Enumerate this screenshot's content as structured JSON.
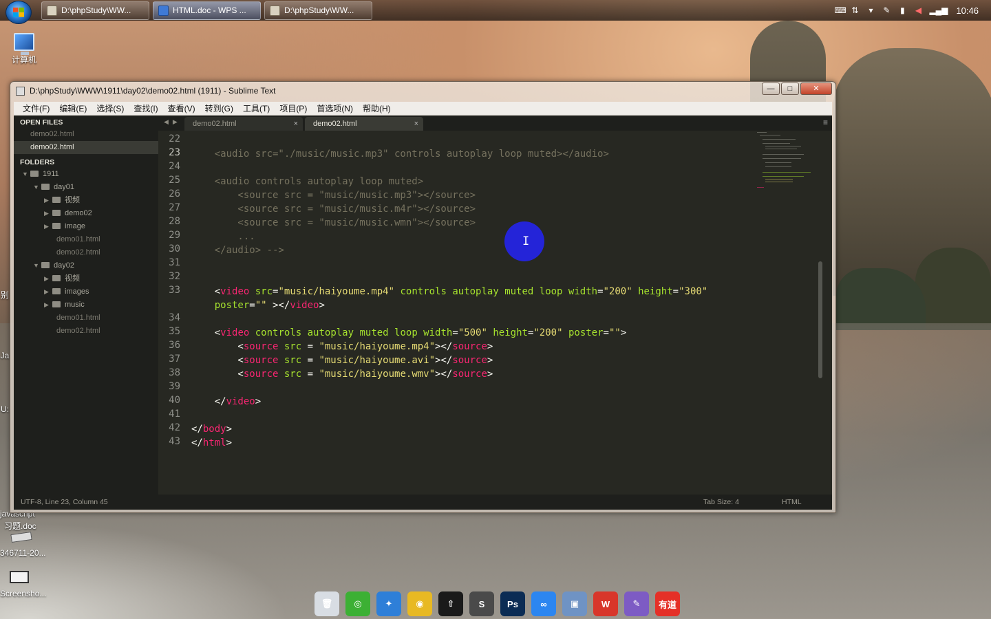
{
  "taskbar": {
    "buttons": [
      {
        "label": "D:\\phpStudy\\WW...",
        "active": false
      },
      {
        "label": "HTML.doc - WPS ...",
        "active": true
      },
      {
        "label": "D:\\phpStudy\\WW...",
        "active": false
      }
    ],
    "clock": "10:46"
  },
  "desktop": {
    "computer_label": "计算机",
    "left_fragments": [
      "Ja",
      "U:",
      "别"
    ],
    "files": [
      "javascript",
      "习题.doc",
      "346711-20...",
      "Screensho..."
    ]
  },
  "window": {
    "title": "D:\\phpStudy\\WWW\\1911\\day02\\demo02.html (1911) - Sublime Text",
    "controls": {
      "minimize": "—",
      "maximize": "□",
      "close": "✕"
    },
    "menu": [
      "文件(F)",
      "编辑(E)",
      "选择(S)",
      "查找(I)",
      "查看(V)",
      "转到(G)",
      "工具(T)",
      "项目(P)",
      "首选项(N)",
      "帮助(H)"
    ]
  },
  "sidebar": {
    "open_files_header": "OPEN FILES",
    "open_files": [
      {
        "name": "demo02.html",
        "selected": false
      },
      {
        "name": "demo02.html",
        "selected": true
      }
    ],
    "folders_header": "FOLDERS",
    "tree": [
      {
        "name": "1911",
        "depth": 0,
        "type": "folder",
        "open": true
      },
      {
        "name": "day01",
        "depth": 1,
        "type": "folder",
        "open": true
      },
      {
        "name": "视频",
        "depth": 2,
        "type": "folder",
        "open": false
      },
      {
        "name": "demo02",
        "depth": 2,
        "type": "folder",
        "open": false
      },
      {
        "name": "image",
        "depth": 2,
        "type": "folder",
        "open": false
      },
      {
        "name": "demo01.html",
        "depth": 2,
        "type": "file"
      },
      {
        "name": "demo02.html",
        "depth": 2,
        "type": "file"
      },
      {
        "name": "day02",
        "depth": 1,
        "type": "folder",
        "open": true
      },
      {
        "name": "视频",
        "depth": 2,
        "type": "folder",
        "open": false
      },
      {
        "name": "images",
        "depth": 2,
        "type": "folder",
        "open": false
      },
      {
        "name": "music",
        "depth": 2,
        "type": "folder",
        "open": false
      },
      {
        "name": "demo01.html",
        "depth": 2,
        "type": "file"
      },
      {
        "name": "demo02.html",
        "depth": 2,
        "type": "file"
      }
    ]
  },
  "tabs": [
    {
      "label": "demo02.html",
      "active": false,
      "close": "×"
    },
    {
      "label": "demo02.html",
      "active": true,
      "close": "×"
    }
  ],
  "editor": {
    "current_line": "23",
    "lines": [
      {
        "n": "22",
        "tokens": []
      },
      {
        "n": "23",
        "tokens": [
          {
            "t": "    <audio src=\"./music/music.mp3\" controls autoplay loop muted></audio>",
            "c": "cm"
          }
        ]
      },
      {
        "n": "24",
        "tokens": []
      },
      {
        "n": "25",
        "tokens": [
          {
            "t": "    <audio controls autoplay loop muted>",
            "c": "cm"
          }
        ]
      },
      {
        "n": "26",
        "tokens": [
          {
            "t": "        <source src = \"music/music.mp3\"></source>",
            "c": "cm"
          }
        ]
      },
      {
        "n": "27",
        "tokens": [
          {
            "t": "        <source src = \"music/music.m4r\"></source>",
            "c": "cm"
          }
        ]
      },
      {
        "n": "28",
        "tokens": [
          {
            "t": "        <source src = \"music/music.wmn\"></source>",
            "c": "cm"
          }
        ]
      },
      {
        "n": "29",
        "tokens": [
          {
            "t": "        ...",
            "c": "cm"
          }
        ]
      },
      {
        "n": "30",
        "tokens": [
          {
            "t": "    </audio> -->",
            "c": "cm"
          }
        ]
      },
      {
        "n": "31",
        "tokens": []
      },
      {
        "n": "32",
        "tokens": []
      },
      {
        "n": "33",
        "tokens": [
          {
            "t": "    <",
            "c": ""
          },
          {
            "t": "video",
            "c": "tg"
          },
          {
            "t": " src",
            "c": "at"
          },
          {
            "t": "=",
            "c": ""
          },
          {
            "t": "\"music/haiyoume.mp4\"",
            "c": "st"
          },
          {
            "t": " controls autoplay muted loop width",
            "c": "at"
          },
          {
            "t": "=",
            "c": ""
          },
          {
            "t": "\"200\"",
            "c": "st"
          },
          {
            "t": " height",
            "c": "at"
          },
          {
            "t": "=",
            "c": ""
          },
          {
            "t": "\"300\"",
            "c": "st"
          }
        ]
      },
      {
        "n": "",
        "tokens": [
          {
            "t": "    poster",
            "c": "at"
          },
          {
            "t": "=",
            "c": ""
          },
          {
            "t": "\"\"",
            "c": "st"
          },
          {
            "t": " ></",
            "c": ""
          },
          {
            "t": "video",
            "c": "tg"
          },
          {
            "t": ">",
            "c": ""
          }
        ]
      },
      {
        "n": "34",
        "tokens": []
      },
      {
        "n": "35",
        "tokens": [
          {
            "t": "    <",
            "c": ""
          },
          {
            "t": "video",
            "c": "tg"
          },
          {
            "t": " controls autoplay muted loop width",
            "c": "at"
          },
          {
            "t": "=",
            "c": ""
          },
          {
            "t": "\"500\"",
            "c": "st"
          },
          {
            "t": " height",
            "c": "at"
          },
          {
            "t": "=",
            "c": ""
          },
          {
            "t": "\"200\"",
            "c": "st"
          },
          {
            "t": " poster",
            "c": "at"
          },
          {
            "t": "=",
            "c": ""
          },
          {
            "t": "\"\"",
            "c": "st"
          },
          {
            "t": ">",
            "c": ""
          }
        ]
      },
      {
        "n": "36",
        "tokens": [
          {
            "t": "        <",
            "c": ""
          },
          {
            "t": "source",
            "c": "tg"
          },
          {
            "t": " src",
            "c": "at"
          },
          {
            "t": " = ",
            "c": ""
          },
          {
            "t": "\"music/haiyoume.mp4\"",
            "c": "st"
          },
          {
            "t": "></",
            "c": ""
          },
          {
            "t": "source",
            "c": "tg"
          },
          {
            "t": ">",
            "c": ""
          }
        ]
      },
      {
        "n": "37",
        "tokens": [
          {
            "t": "        <",
            "c": ""
          },
          {
            "t": "source",
            "c": "tg"
          },
          {
            "t": " src",
            "c": "at"
          },
          {
            "t": " = ",
            "c": ""
          },
          {
            "t": "\"music/haiyoume.avi\"",
            "c": "st"
          },
          {
            "t": "></",
            "c": ""
          },
          {
            "t": "source",
            "c": "tg"
          },
          {
            "t": ">",
            "c": ""
          }
        ]
      },
      {
        "n": "38",
        "tokens": [
          {
            "t": "        <",
            "c": ""
          },
          {
            "t": "source",
            "c": "tg"
          },
          {
            "t": " src",
            "c": "at"
          },
          {
            "t": " = ",
            "c": ""
          },
          {
            "t": "\"music/haiyoume.wmv\"",
            "c": "st"
          },
          {
            "t": "></",
            "c": ""
          },
          {
            "t": "source",
            "c": "tg"
          },
          {
            "t": ">",
            "c": ""
          }
        ]
      },
      {
        "n": "39",
        "tokens": []
      },
      {
        "n": "40",
        "tokens": [
          {
            "t": "    </",
            "c": ""
          },
          {
            "t": "video",
            "c": "tg"
          },
          {
            "t": ">",
            "c": ""
          }
        ]
      },
      {
        "n": "41",
        "tokens": []
      },
      {
        "n": "42",
        "tokens": [
          {
            "t": "</",
            "c": ""
          },
          {
            "t": "body",
            "c": "tg"
          },
          {
            "t": ">",
            "c": ""
          }
        ]
      },
      {
        "n": "43",
        "tokens": [
          {
            "t": "</",
            "c": ""
          },
          {
            "t": "html",
            "c": "tg"
          },
          {
            "t": ">",
            "c": ""
          }
        ]
      }
    ]
  },
  "status": {
    "left": "UTF-8, Line 23, Column 45",
    "tab_size": "Tab Size: 4",
    "syntax": "HTML"
  },
  "dock": [
    {
      "name": "recycle-bin-icon",
      "color": "#d8dde3",
      "glyph": "🗑"
    },
    {
      "name": "wechat-icon",
      "color": "#3cb034",
      "glyph": "◎"
    },
    {
      "name": "safari-icon",
      "color": "#2e7fd8",
      "glyph": "✦"
    },
    {
      "name": "chrome-icon",
      "color": "#e8b923",
      "glyph": "◉"
    },
    {
      "name": "app-icon",
      "color": "#1a1a1a",
      "glyph": "⇧"
    },
    {
      "name": "sublime-icon",
      "color": "#4a4a4a",
      "glyph": "S"
    },
    {
      "name": "photoshop-icon",
      "color": "#0b2c54",
      "glyph": "Ps"
    },
    {
      "name": "baidu-cloud-icon",
      "color": "#2c86f0",
      "glyph": "∞"
    },
    {
      "name": "monitor-icon",
      "color": "#6f93c4",
      "glyph": "▣"
    },
    {
      "name": "wps-icon",
      "color": "#d8362a",
      "glyph": "W"
    },
    {
      "name": "feather-icon",
      "color": "#7d5bc4",
      "glyph": "✎"
    },
    {
      "name": "youdao-icon",
      "color": "#e53027",
      "glyph": "有道"
    }
  ]
}
